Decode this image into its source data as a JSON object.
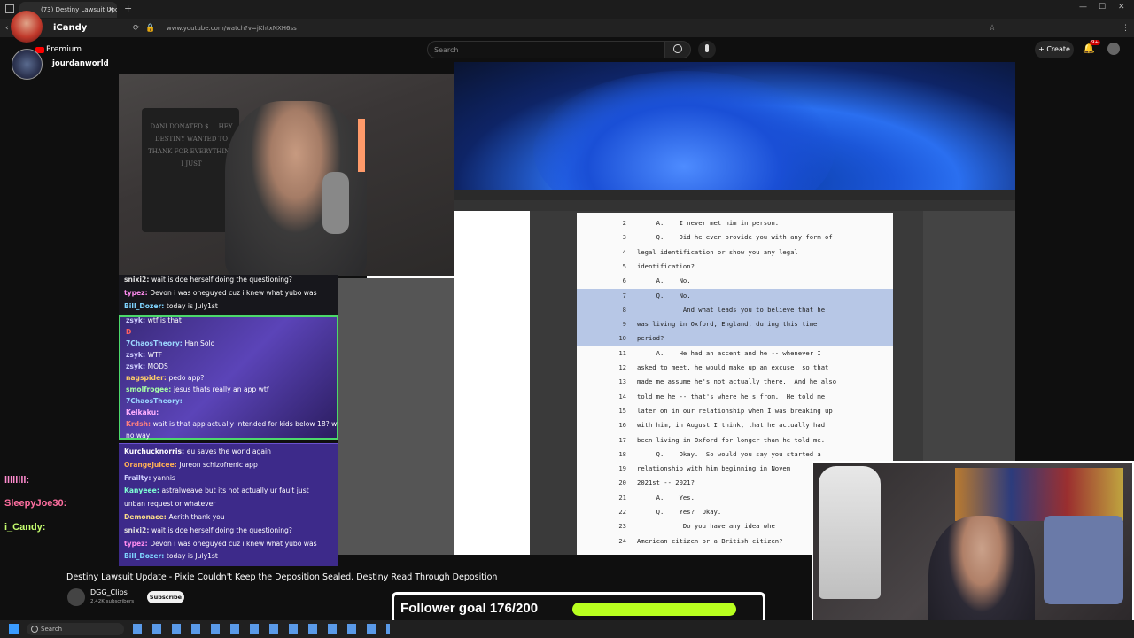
{
  "browser": {
    "tab_title": "(73) Destiny Lawsuit Updat",
    "url": "www.youtube.com/watch?v=jKhtxNXH6ss"
  },
  "left_panel": {
    "streamer_name": "iCandy",
    "premium_label": "Premium",
    "account_name": "jourdanworld",
    "chat_names": [
      "llllllll:",
      "SleepyJoe30:",
      "i_Candy:"
    ]
  },
  "yt_header": {
    "search_placeholder": "Search",
    "create_label": "Create",
    "notif_count": "9+"
  },
  "document": {
    "lines": [
      {
        "n": "2",
        "t": "     A.    I never met him in person.",
        "hl": false
      },
      {
        "n": "3",
        "t": "     Q.    Did he ever provide you with any form of",
        "hl": false
      },
      {
        "n": "4",
        "t": "legal identification or show you any legal",
        "hl": false
      },
      {
        "n": "5",
        "t": "identification?",
        "hl": false
      },
      {
        "n": "6",
        "t": "     A.    No.",
        "hl": false
      },
      {
        "n": "7",
        "t": "     Q.    No.",
        "hl": true
      },
      {
        "n": "8",
        "t": "            And what leads you to believe that he",
        "hl": true
      },
      {
        "n": "9",
        "t": "was living in Oxford, England, during this time",
        "hl": true
      },
      {
        "n": "10",
        "t": "period?",
        "hl": true
      },
      {
        "n": "11",
        "t": "     A.    He had an accent and he -- whenever I",
        "hl": false
      },
      {
        "n": "12",
        "t": "asked to meet, he would make up an excuse; so that",
        "hl": false
      },
      {
        "n": "13",
        "t": "made me assume he's not actually there.  And he also",
        "hl": false
      },
      {
        "n": "14",
        "t": "told me he -- that's where he's from.  He told me",
        "hl": false
      },
      {
        "n": "15",
        "t": "later on in our relationship when I was breaking up",
        "hl": false
      },
      {
        "n": "16",
        "t": "with him, in August I think, that he actually had",
        "hl": false
      },
      {
        "n": "17",
        "t": "been living in Oxford for longer than he told me.",
        "hl": false
      },
      {
        "n": "18",
        "t": "     Q.    Okay.  So would you say you started a",
        "hl": false
      },
      {
        "n": "19",
        "t": "relationship with him beginning in Novem",
        "hl": false
      },
      {
        "n": "20",
        "t": "2021st -- 2021?",
        "hl": false
      },
      {
        "n": "21",
        "t": "     A.    Yes.",
        "hl": false
      },
      {
        "n": "22",
        "t": "     Q.    Yes?  Okay.",
        "hl": false
      },
      {
        "n": "23",
        "t": "            Do you have any idea whe",
        "hl": false
      },
      {
        "n": "24",
        "t": "American citizen or a British citizen?",
        "hl": false
      }
    ]
  },
  "webcam_sign": "DANI DONATED $ ... HEY DESTINY WANTED TO THANK FOR EVERYTHING I JUST",
  "chat_top": [
    {
      "user": "snixi2:",
      "msg": "wait is doe herself doing the questioning?",
      "color": "#dddddd"
    },
    {
      "user": "typez:",
      "msg": "Devon i was oneguyed cuz i knew what yubo was",
      "color": "#ff8cf0"
    },
    {
      "user": "Bill_Dozer:",
      "msg": "today is July1st",
      "color": "#7fd4ff"
    }
  ],
  "chat_mid": [
    {
      "user": "zsyk:",
      "msg": "wtf is that",
      "color": "#cfcfff"
    },
    {
      "user": "D",
      "msg": "",
      "color": "#ff6060"
    },
    {
      "user": "7ChaosTheory:",
      "msg": "Han Solo",
      "color": "#9cd7ff"
    },
    {
      "user": "zsyk:",
      "msg": "WTF",
      "color": "#cfcfff"
    },
    {
      "user": "zsyk:",
      "msg": "MODS",
      "color": "#cfcfff"
    },
    {
      "user": "nagspider:",
      "msg": "pedo app?",
      "color": "#ffcf66"
    },
    {
      "user": "smolfrogee:",
      "msg": "jesus thats really an app wtf",
      "color": "#a6ffa6"
    },
    {
      "user": "7ChaosTheory:",
      "msg": "",
      "color": "#9cd7ff"
    },
    {
      "user": "Kelkaku:",
      "msg": "",
      "color": "#ffb0ff"
    },
    {
      "user": "Krdsh:",
      "msg": "wait is that app actually intended for kids below 18? wtf",
      "color": "#ff7f7f"
    },
    {
      "user": "",
      "msg": "no way",
      "color": "#ffffff"
    }
  ],
  "chat_bottom": [
    {
      "user": "Kurchucknorris:",
      "msg": "eu saves the world again",
      "color": "#ffffff"
    },
    {
      "user": "Orangejuicee:",
      "msg": "Jureon schizofrenic app",
      "color": "#ffb055"
    },
    {
      "user": "Frailty:",
      "msg": "yannis",
      "color": "#d0d0ff"
    },
    {
      "user": "Kanyeee:",
      "msg": "astralweave but its not actually ur fault  just",
      "color": "#7fffd4"
    },
    {
      "user": "",
      "msg": "unban request or whatever",
      "color": "#ffffff"
    },
    {
      "user": "Demonace:",
      "msg": "Aerith  thank you",
      "color": "#ffe08a"
    },
    {
      "user": "snixi2:",
      "msg": "wait is doe herself doing the questioning?",
      "color": "#dddddd"
    },
    {
      "user": "typez:",
      "msg": "Devon i was oneguyed cuz i knew what yubo was",
      "color": "#ff8cf0"
    },
    {
      "user": "Bill_Dozer:",
      "msg": "today is July1st",
      "color": "#7fd4ff"
    }
  ],
  "video": {
    "title": "Destiny Lawsuit Update - Pixie Couldn't Keep the Deposition Sealed. Destiny Read Through Deposition",
    "channel": "DGG_Clips",
    "subscribers": "2.42K subscribers",
    "subscribe_label": "Subscribe"
  },
  "follower_goal": {
    "text": "Follower goal 176/200",
    "progress": 0.88
  },
  "taskbar": {
    "search_label": "Search"
  }
}
